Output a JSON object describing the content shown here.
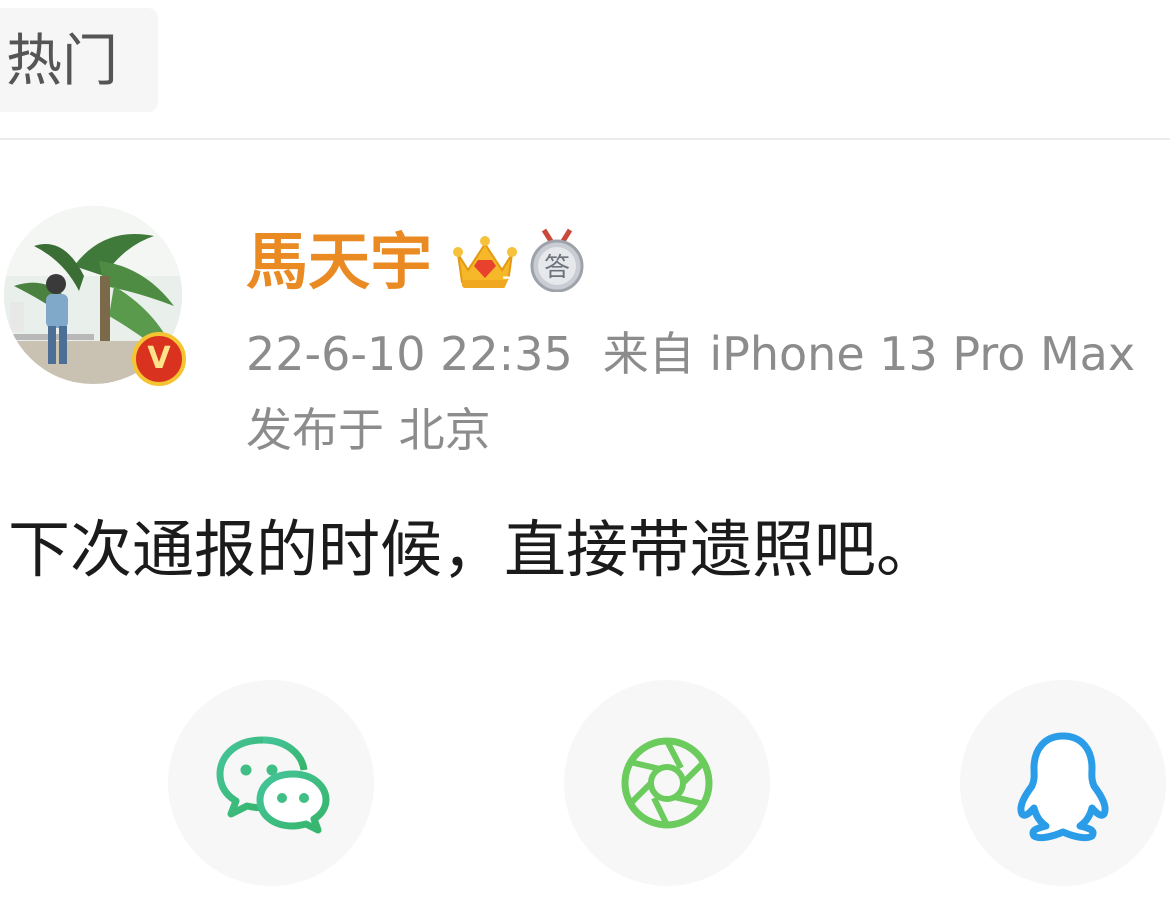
{
  "tabs": {
    "active_label": "热门"
  },
  "post": {
    "author_name": "馬天宇",
    "verified_mark": "V",
    "badges": [
      "crown-level-icon",
      "answer-medal-icon"
    ],
    "answer_badge_text": "答",
    "timestamp": "22-6-10 22:35",
    "source": "来自 iPhone 13 Pro Max",
    "location": "发布于 北京",
    "text": "下次通报的时候，直接带遗照吧。"
  },
  "share": {
    "targets": [
      "wechat-icon",
      "moments-icon",
      "qq-icon"
    ]
  },
  "colors": {
    "author_name": "#e98a23",
    "meta_text": "#8c8c8c",
    "wechat": "#3fc27a",
    "moments": "#66c95a",
    "qq": "#2b9de8"
  }
}
